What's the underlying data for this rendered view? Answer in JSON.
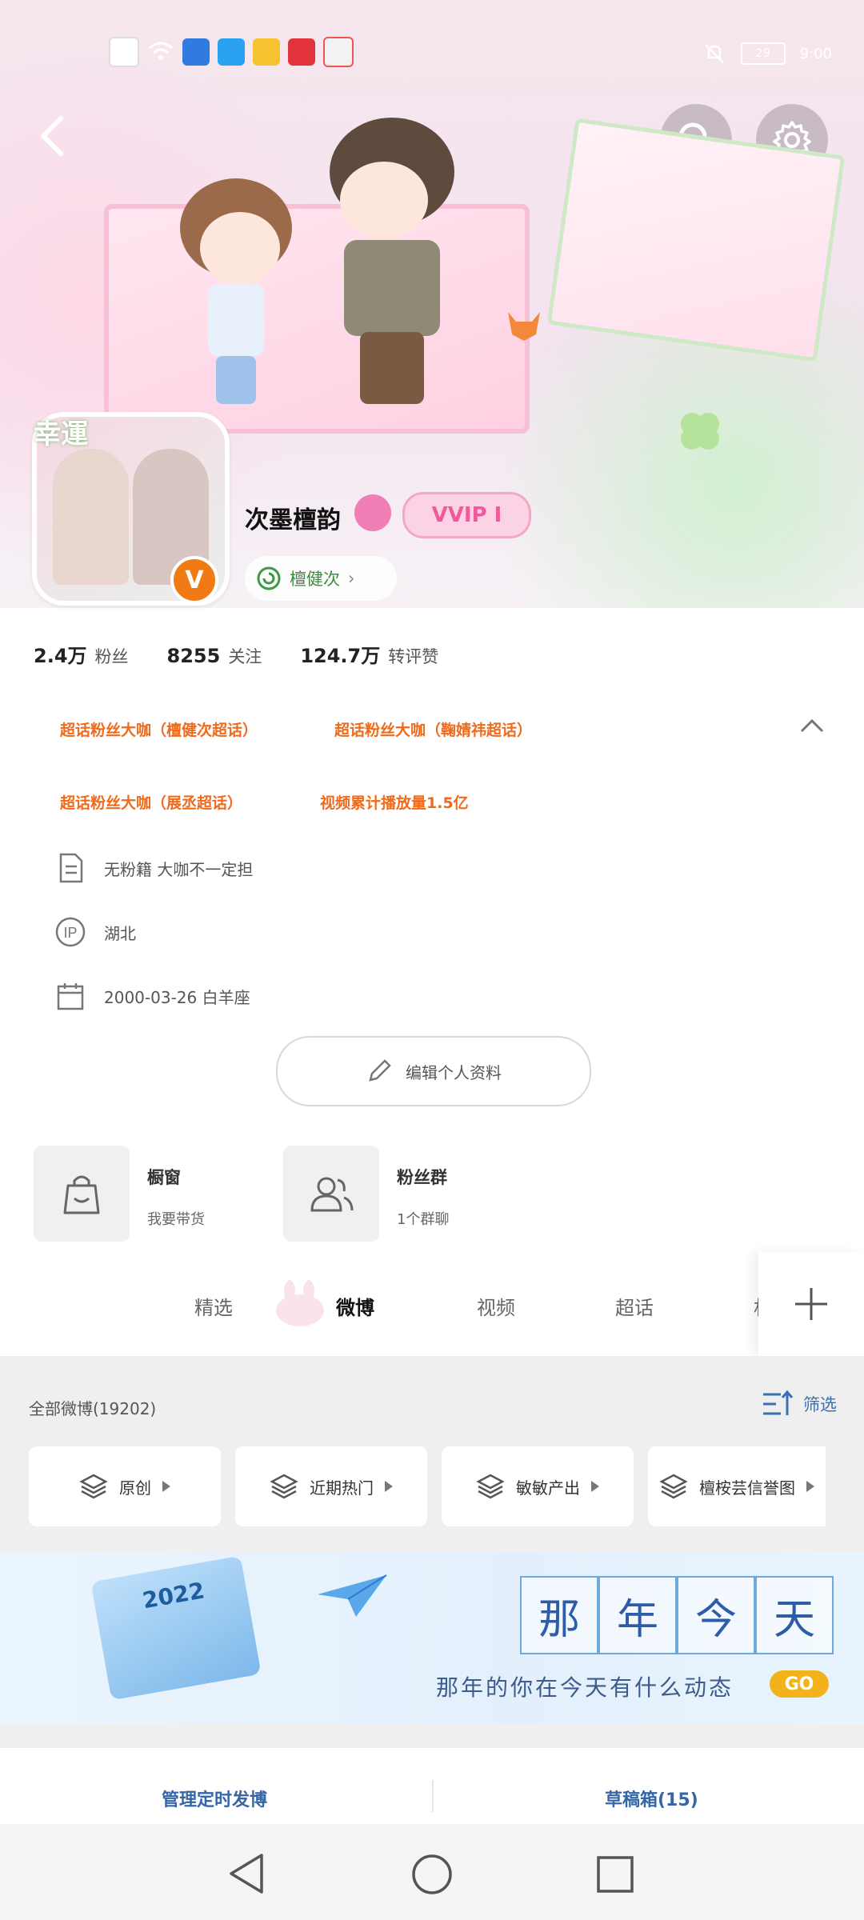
{
  "status_bar": {
    "time": "9:00",
    "battery": "29"
  },
  "header": {
    "avatar_badge": "幸運",
    "username": "次墨檀韵",
    "vip_label": "VVIP I",
    "linked_chip": "檀健次"
  },
  "stats": [
    {
      "value": "2.4万",
      "label": "粉丝"
    },
    {
      "value": "8255",
      "label": "关注"
    },
    {
      "value": "124.7万",
      "label": "转评赞"
    }
  ],
  "tags": [
    "超话粉丝大咖（檀健次超话）",
    "超话粉丝大咖（鞠婧祎超话）",
    "超话粉丝大咖（展丞超话）",
    "视频累计播放量1.5亿"
  ],
  "info": {
    "bio": "无粉籍 大咖不一定担",
    "ip": "湖北",
    "birthday": "2000-03-26 白羊座"
  },
  "edit_profile": "编辑个人资料",
  "features": [
    {
      "title": "橱窗",
      "subtitle": "我要带货"
    },
    {
      "title": "粉丝群",
      "subtitle": "1个群聊"
    }
  ],
  "tabs": [
    "精选",
    "微博",
    "视频",
    "超话",
    "相"
  ],
  "feed": {
    "all_count": "全部微博(19202)",
    "filter_label": "筛选",
    "chips": [
      "原创",
      "近期热门",
      "敏敏产出",
      "檀桉芸信誉图"
    ]
  },
  "banner": {
    "year": "2022",
    "chars": [
      "那",
      "年",
      "今",
      "天"
    ],
    "subtitle": "那年的你在今天有什么动态",
    "go": "GO"
  },
  "bottom_actions": {
    "scheduled": "管理定时发博",
    "drafts": "草稿箱(15)"
  }
}
